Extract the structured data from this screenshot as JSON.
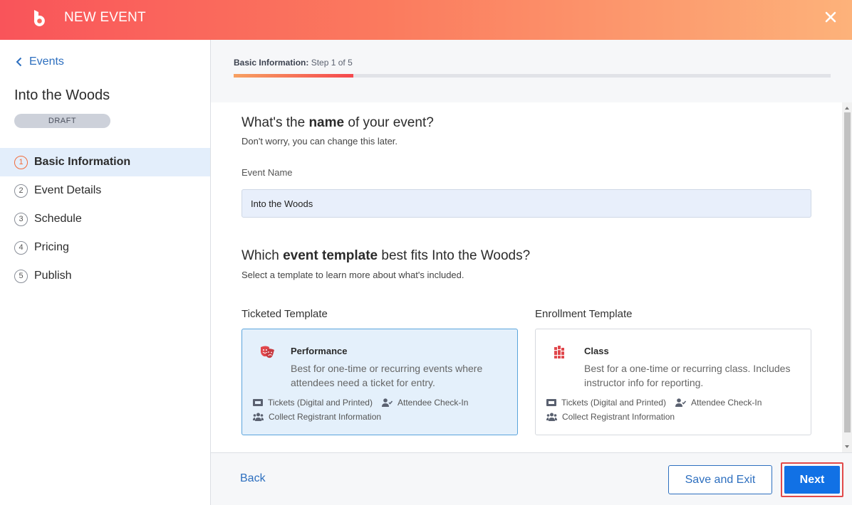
{
  "header": {
    "title": "NEW EVENT",
    "logo_icon": "brand-b-logo",
    "close_icon": "close-icon",
    "gradient": [
      "#f9545a",
      "#fdb27a"
    ]
  },
  "sidebar": {
    "back_label": "Events",
    "event_title": "Into the Woods",
    "status_badge": "DRAFT",
    "steps": [
      {
        "num": "1",
        "label": "Basic Information",
        "active": true
      },
      {
        "num": "2",
        "label": "Event Details",
        "active": false
      },
      {
        "num": "3",
        "label": "Schedule",
        "active": false
      },
      {
        "num": "4",
        "label": "Pricing",
        "active": false
      },
      {
        "num": "5",
        "label": "Publish",
        "active": false
      }
    ]
  },
  "progress": {
    "section": "Basic Information:",
    "step_text": "Step 1 of 5",
    "fraction": 0.2
  },
  "form": {
    "q1_pre": "What's the ",
    "q1_bold": "name",
    "q1_post": " of your event?",
    "q1_sub": "Don't worry, you can change this later.",
    "event_name_label": "Event Name",
    "event_name_value": "Into the Woods",
    "q2_pre": "Which ",
    "q2_bold": "event template",
    "q2_post": " best fits Into the Woods?",
    "q2_sub": "Select a template to learn more about what's included."
  },
  "templates": [
    {
      "heading": "Ticketed Template",
      "name": "Performance",
      "icon": "theater-masks-icon",
      "description": "Best for one-time or recurring events where attendees need a ticket for entry.",
      "features": [
        "Tickets (Digital and Printed)",
        "Attendee Check-In",
        "Collect Registrant Information"
      ],
      "selected": true
    },
    {
      "heading": "Enrollment Template",
      "name": "Class",
      "icon": "books-icon",
      "description": "Best for a one-time or recurring class. Includes instructor info for reporting.",
      "features": [
        "Tickets (Digital and Printed)",
        "Attendee Check-In",
        "Collect Registrant Information"
      ],
      "selected": false
    }
  ],
  "footer": {
    "back_label": "Back",
    "save_label": "Save and Exit",
    "next_label": "Next"
  },
  "colors": {
    "accent_blue": "#1171e5",
    "link_blue": "#2d6fbf",
    "active_step": "#f26b3a",
    "icon_red": "#e0474c"
  }
}
